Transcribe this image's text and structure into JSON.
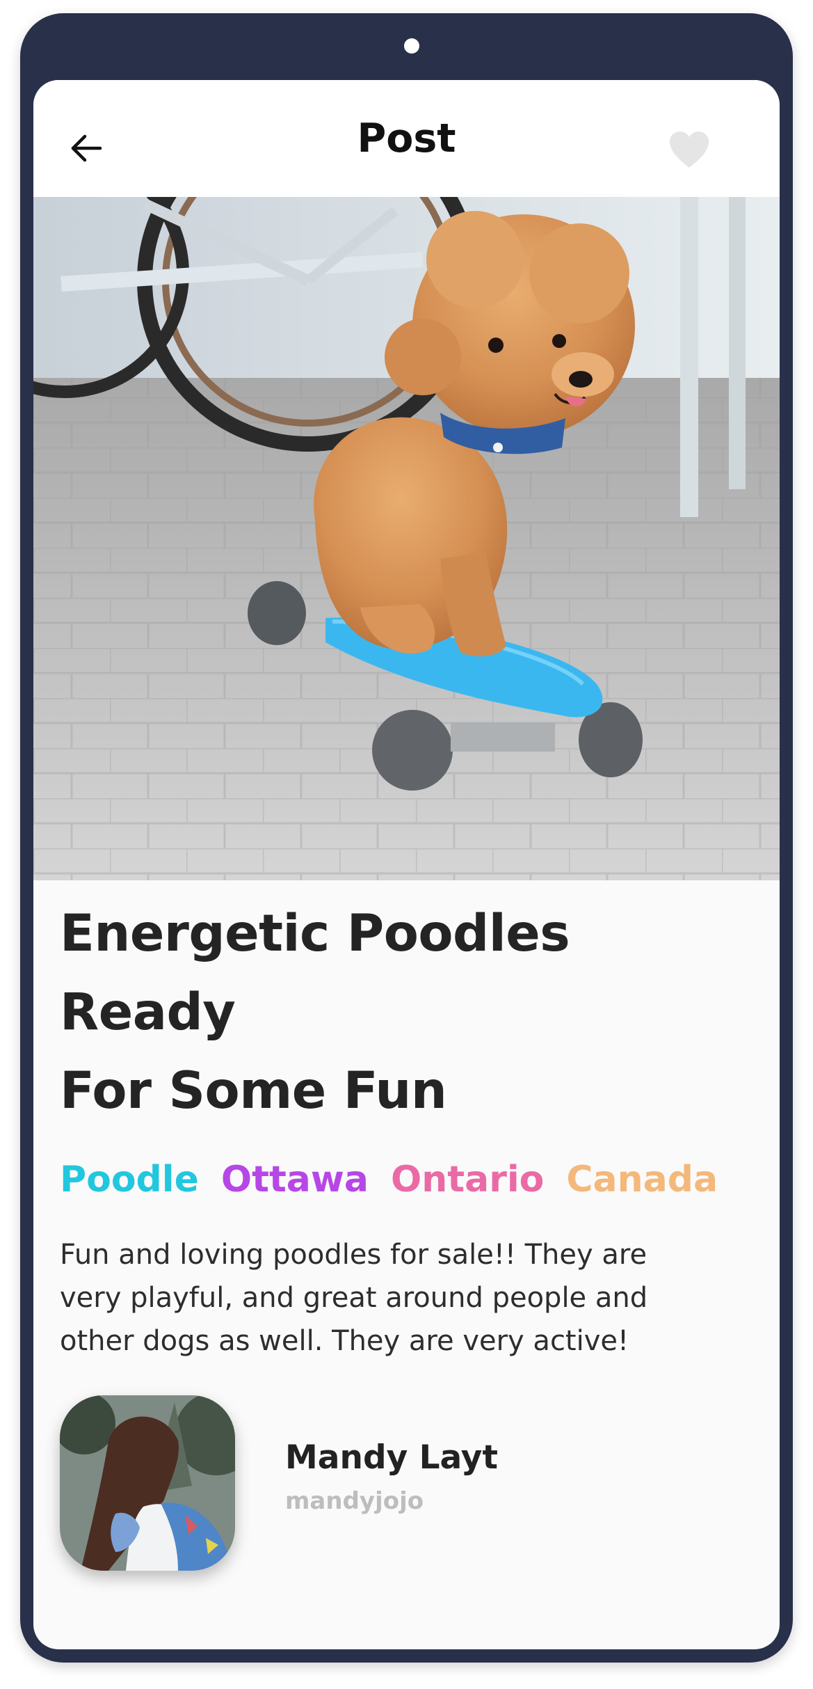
{
  "header": {
    "title": "Post",
    "back_icon": "arrow-left-icon",
    "favorite_icon": "heart-icon"
  },
  "post": {
    "title_line1": "Energetic Poodles Ready",
    "title_line2": "For Some Fun",
    "tags": [
      {
        "label": "Poodle",
        "color": "#22c7df"
      },
      {
        "label": "Ottawa",
        "color": "#b647e6"
      },
      {
        "label": "Ontario",
        "color": "#ea6aa6"
      },
      {
        "label": "Canada",
        "color": "#f3b87a"
      }
    ],
    "description_line1": "Fun and loving poodles for sale!! They are",
    "description_line2": "very playful, and great around people and",
    "description_line3": "other dogs as well. They are very active!"
  },
  "author": {
    "name": "Mandy Layt",
    "handle": "mandyjojo"
  },
  "colors": {
    "frame": "#29304a",
    "screen_background": "#fafafa",
    "text_primary": "#242424",
    "text_muted": "#bdbdbd",
    "favorite_heart": "#e5e5e5"
  }
}
